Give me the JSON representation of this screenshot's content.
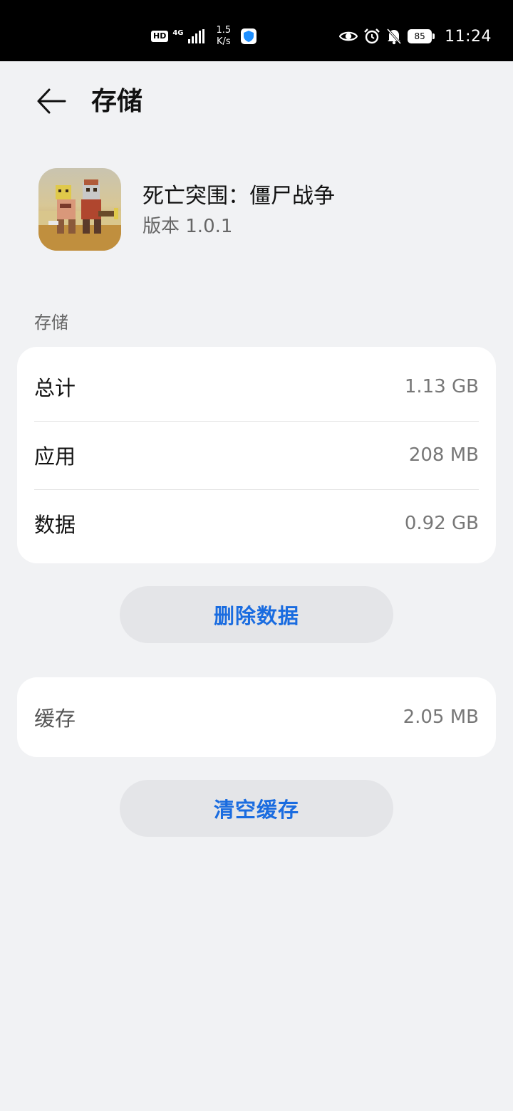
{
  "status_bar": {
    "hd": "HD",
    "network": "4G",
    "speed_value": "1.5",
    "speed_unit": "K/s",
    "battery": "85",
    "time": "11:24",
    "icons": [
      "signal-icon",
      "shield-icon",
      "eye-icon",
      "alarm-icon",
      "bell-off-icon",
      "battery-icon"
    ]
  },
  "header": {
    "title": "存储"
  },
  "app": {
    "name": "死亡突围：僵尸战争",
    "version": "版本 1.0.1"
  },
  "storage_section": {
    "label": "存储",
    "rows": [
      {
        "label": "总计",
        "value": "1.13 GB"
      },
      {
        "label": "应用",
        "value": "208 MB"
      },
      {
        "label": "数据",
        "value": "0.92 GB"
      }
    ]
  },
  "delete_button": "删除数据",
  "cache": {
    "label": "缓存",
    "value": "2.05 MB"
  },
  "clear_button": "清空缓存",
  "colors": {
    "accent": "#1a6ce0",
    "background": "#f1f2f4",
    "card": "#ffffff",
    "button": "#e4e5e8"
  }
}
